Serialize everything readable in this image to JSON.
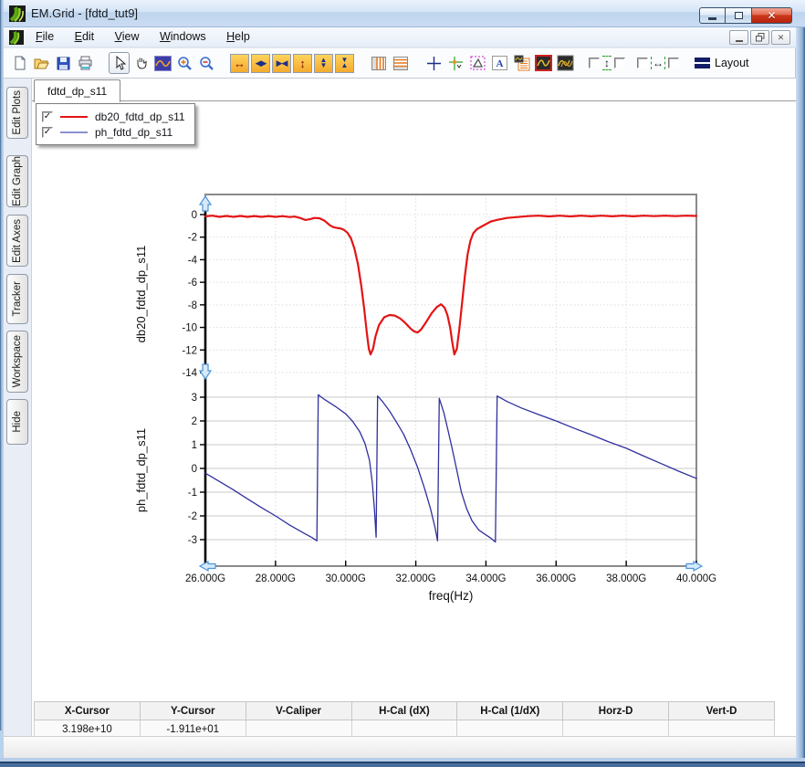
{
  "window": {
    "title": "EM.Grid - [fdtd_tut9]"
  },
  "menu": {
    "items": [
      "File",
      "Edit",
      "View",
      "Windows",
      "Help"
    ]
  },
  "toolbar": {
    "layout_label": "Layout"
  },
  "sidebar": {
    "tabs": [
      "Edit Plots",
      "Edit Graph",
      "Edit Axes",
      "Tracker",
      "Workspace",
      "Hide"
    ]
  },
  "document_tab": "fdtd_dp_s11",
  "legend": {
    "items": [
      {
        "label": "db20_fdtd_dp_s11",
        "color": "#e41414",
        "checked": true
      },
      {
        "label": "ph_fdtd_dp_s11",
        "color": "#8a90cc",
        "checked": true
      }
    ]
  },
  "chart_data": {
    "type": "line",
    "xlabel": "freq(Hz)",
    "xlim_ghz": [
      26,
      40
    ],
    "xticks": [
      26,
      28,
      30,
      32,
      34,
      36,
      38,
      40
    ],
    "xtick_labels": [
      "26.000G",
      "28.000G",
      "30.000G",
      "32.000G",
      "34.000G",
      "36.000G",
      "38.000G",
      "40.000G"
    ],
    "grid_vertical": "dotted",
    "subplots": [
      {
        "ylabel": "db20_fdtd_dp_s11",
        "yticks": [
          0,
          -2,
          -4,
          -6,
          -8,
          -10,
          -12,
          -14
        ],
        "ylim": [
          -14,
          1.8
        ],
        "grid_horizontal": "dotted",
        "series": [
          {
            "name": "db20_fdtd_dp_s11",
            "color": "#e41414",
            "width": 2.2,
            "points": [
              [
                26.0,
                -0.15
              ],
              [
                26.2,
                -0.1
              ],
              [
                26.4,
                -0.2
              ],
              [
                26.6,
                -0.12
              ],
              [
                26.8,
                -0.2
              ],
              [
                27.0,
                -0.12
              ],
              [
                27.2,
                -0.2
              ],
              [
                27.4,
                -0.13
              ],
              [
                27.6,
                -0.2
              ],
              [
                27.8,
                -0.13
              ],
              [
                28.0,
                -0.2
              ],
              [
                28.2,
                -0.14
              ],
              [
                28.4,
                -0.22
              ],
              [
                28.55,
                -0.18
              ],
              [
                28.7,
                -0.3
              ],
              [
                28.85,
                -0.48
              ],
              [
                29.0,
                -0.4
              ],
              [
                29.1,
                -0.3
              ],
              [
                29.25,
                -0.32
              ],
              [
                29.4,
                -0.55
              ],
              [
                29.55,
                -0.95
              ],
              [
                29.65,
                -1.12
              ],
              [
                29.75,
                -1.18
              ],
              [
                29.85,
                -1.22
              ],
              [
                29.95,
                -1.35
              ],
              [
                30.05,
                -1.6
              ],
              [
                30.15,
                -2.1
              ],
              [
                30.25,
                -3.0
              ],
              [
                30.35,
                -4.4
              ],
              [
                30.45,
                -6.4
              ],
              [
                30.53,
                -8.4
              ],
              [
                30.6,
                -10.4
              ],
              [
                30.66,
                -11.9
              ],
              [
                30.71,
                -12.4
              ],
              [
                30.78,
                -11.9
              ],
              [
                30.85,
                -10.8
              ],
              [
                30.95,
                -9.8
              ],
              [
                31.1,
                -9.1
              ],
              [
                31.25,
                -8.9
              ],
              [
                31.4,
                -8.95
              ],
              [
                31.55,
                -9.2
              ],
              [
                31.7,
                -9.6
              ],
              [
                31.85,
                -10.1
              ],
              [
                31.95,
                -10.35
              ],
              [
                32.05,
                -10.45
              ],
              [
                32.15,
                -10.2
              ],
              [
                32.3,
                -9.5
              ],
              [
                32.45,
                -8.75
              ],
              [
                32.6,
                -8.2
              ],
              [
                32.72,
                -7.95
              ],
              [
                32.82,
                -8.25
              ],
              [
                32.9,
                -8.9
              ],
              [
                32.98,
                -10.0
              ],
              [
                33.04,
                -11.3
              ],
              [
                33.1,
                -12.4
              ],
              [
                33.17,
                -11.9
              ],
              [
                33.24,
                -10.2
              ],
              [
                33.32,
                -7.8
              ],
              [
                33.4,
                -5.4
              ],
              [
                33.48,
                -3.5
              ],
              [
                33.56,
                -2.3
              ],
              [
                33.64,
                -1.65
              ],
              [
                33.74,
                -1.3
              ],
              [
                33.88,
                -1.05
              ],
              [
                34.0,
                -0.85
              ],
              [
                34.15,
                -0.6
              ],
              [
                34.35,
                -0.45
              ],
              [
                34.6,
                -0.3
              ],
              [
                34.9,
                -0.22
              ],
              [
                35.2,
                -0.14
              ],
              [
                35.5,
                -0.1
              ],
              [
                35.8,
                -0.16
              ],
              [
                36.1,
                -0.1
              ],
              [
                36.4,
                -0.16
              ],
              [
                36.7,
                -0.1
              ],
              [
                37.0,
                -0.15
              ],
              [
                37.3,
                -0.1
              ],
              [
                37.6,
                -0.15
              ],
              [
                37.9,
                -0.1
              ],
              [
                38.2,
                -0.15
              ],
              [
                38.5,
                -0.1
              ],
              [
                38.8,
                -0.14
              ],
              [
                39.1,
                -0.1
              ],
              [
                39.4,
                -0.14
              ],
              [
                39.7,
                -0.1
              ],
              [
                40.0,
                -0.12
              ]
            ]
          }
        ]
      },
      {
        "ylabel": "ph_fdtd_dp_s11",
        "yticks": [
          3,
          2,
          1,
          0,
          -1,
          -2,
          -3
        ],
        "ylim": [
          -3.6,
          3.6
        ],
        "grid_horizontal": "solid",
        "series": [
          {
            "name": "ph_fdtd_dp_s11",
            "color": "#30309e",
            "width": 1.3,
            "points": [
              [
                26.0,
                -0.2
              ],
              [
                26.4,
                -0.55
              ],
              [
                26.8,
                -0.9
              ],
              [
                27.2,
                -1.28
              ],
              [
                27.6,
                -1.65
              ],
              [
                28.0,
                -2.0
              ],
              [
                28.4,
                -2.38
              ],
              [
                28.8,
                -2.72
              ],
              [
                29.05,
                -2.92
              ],
              [
                29.18,
                -3.05
              ],
              [
                29.22,
                3.1
              ],
              [
                29.4,
                2.9
              ],
              [
                29.7,
                2.62
              ],
              [
                30.0,
                2.3
              ],
              [
                30.2,
                1.98
              ],
              [
                30.4,
                1.55
              ],
              [
                30.55,
                1.05
              ],
              [
                30.68,
                0.35
              ],
              [
                30.76,
                -0.6
              ],
              [
                30.82,
                -1.7
              ],
              [
                30.87,
                -2.9
              ],
              [
                30.91,
                3.05
              ],
              [
                31.05,
                2.82
              ],
              [
                31.25,
                2.42
              ],
              [
                31.45,
                1.95
              ],
              [
                31.65,
                1.45
              ],
              [
                31.85,
                0.8
              ],
              [
                32.05,
                0.05
              ],
              [
                32.25,
                -0.85
              ],
              [
                32.42,
                -1.7
              ],
              [
                32.55,
                -2.5
              ],
              [
                32.62,
                -3.05
              ],
              [
                32.67,
                2.95
              ],
              [
                32.8,
                2.35
              ],
              [
                32.92,
                1.6
              ],
              [
                33.05,
                0.75
              ],
              [
                33.18,
                -0.15
              ],
              [
                33.3,
                -1.0
              ],
              [
                33.45,
                -1.7
              ],
              [
                33.6,
                -2.2
              ],
              [
                33.8,
                -2.6
              ],
              [
                34.0,
                -2.8
              ],
              [
                34.15,
                -2.95
              ],
              [
                34.27,
                -3.1
              ],
              [
                34.32,
                3.05
              ],
              [
                34.6,
                2.82
              ],
              [
                35.0,
                2.55
              ],
              [
                35.5,
                2.27
              ],
              [
                36.0,
                2.0
              ],
              [
                36.5,
                1.7
              ],
              [
                37.0,
                1.42
              ],
              [
                37.5,
                1.12
              ],
              [
                38.0,
                0.85
              ],
              [
                38.5,
                0.52
              ],
              [
                39.0,
                0.2
              ],
              [
                39.5,
                -0.12
              ],
              [
                40.0,
                -0.42
              ]
            ]
          }
        ]
      }
    ]
  },
  "status_table": {
    "headers": [
      "X-Cursor",
      "Y-Cursor",
      "V-Caliper",
      "H-Cal (dX)",
      "H-Cal (1/dX)",
      "Horz-D",
      "Vert-D"
    ],
    "values": [
      "3.198e+10",
      "-1.911e+01",
      "",
      "",
      "",
      "",
      ""
    ]
  }
}
